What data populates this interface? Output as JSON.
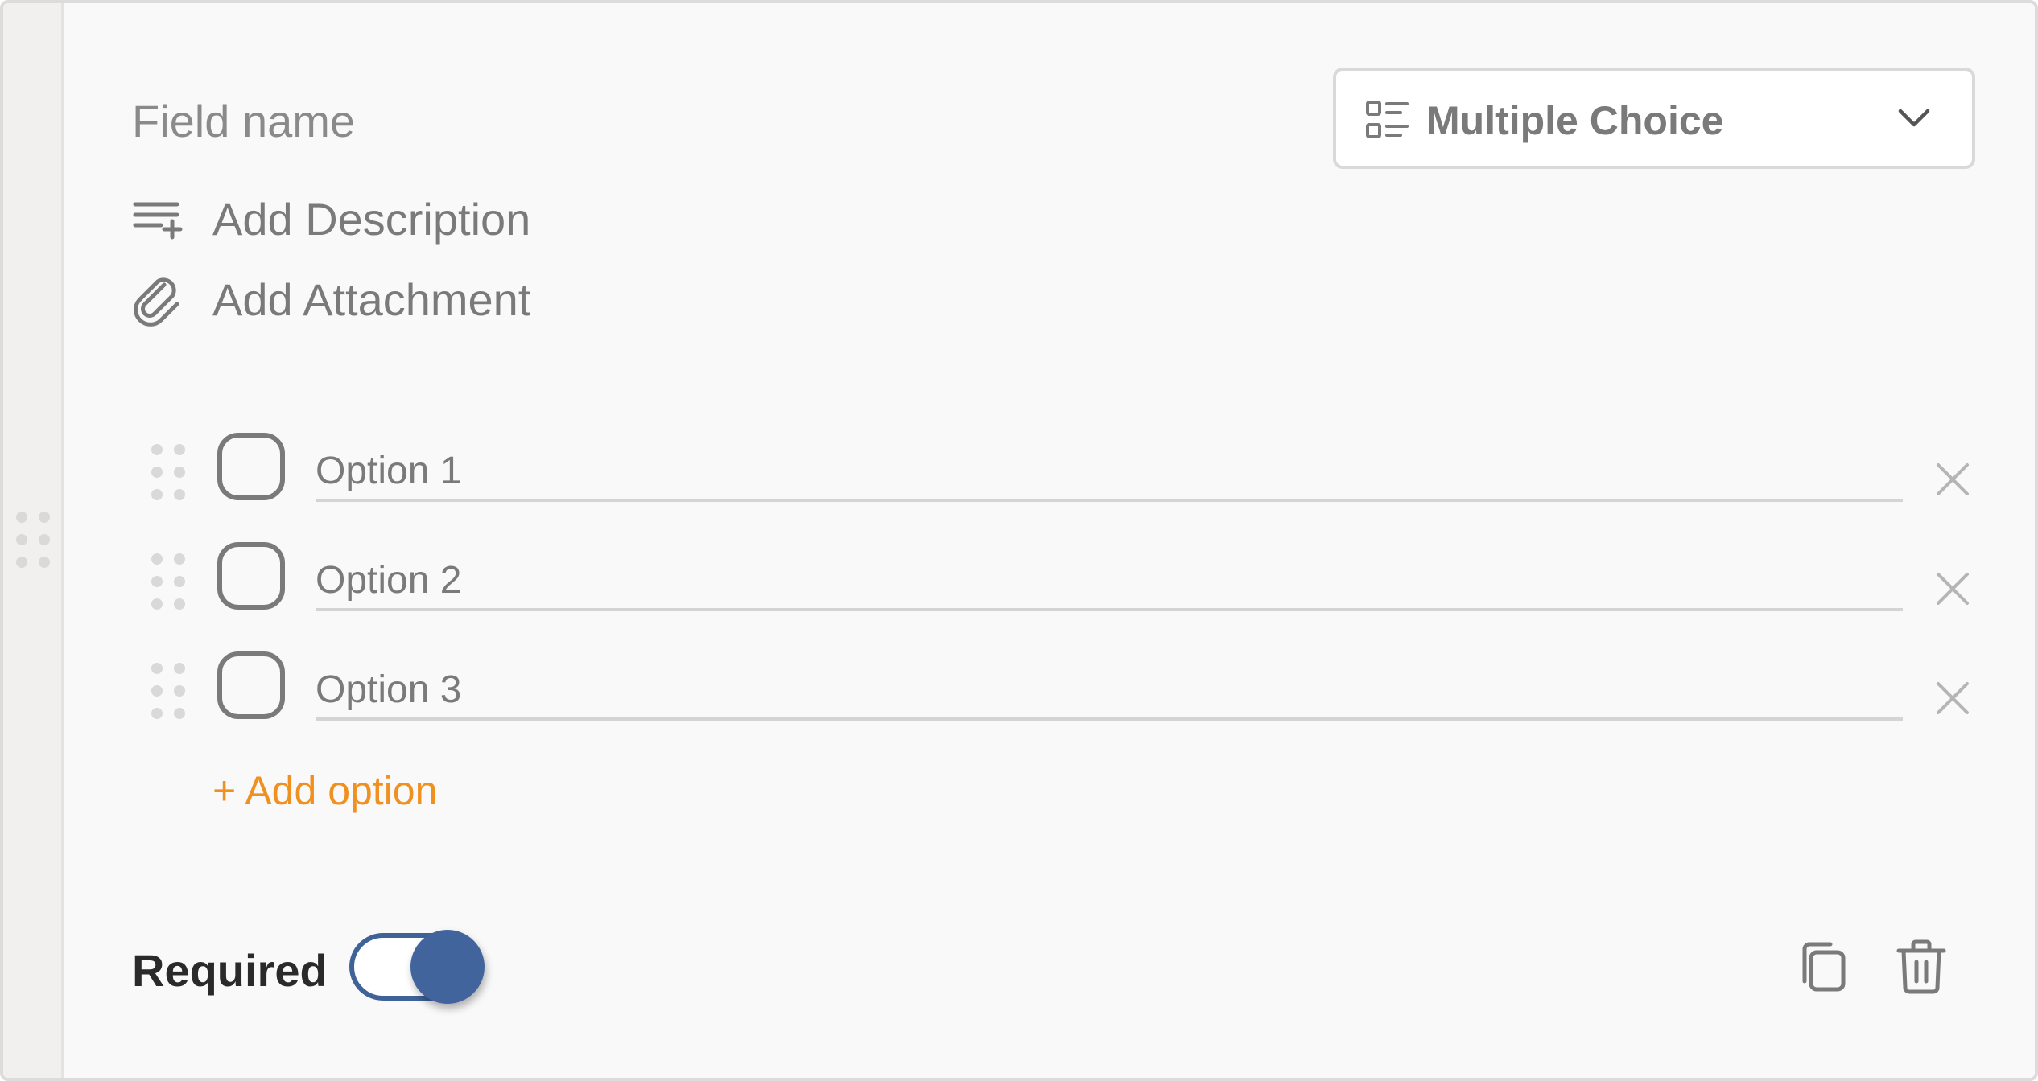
{
  "field": {
    "name_placeholder": "Field name",
    "type": {
      "label": "Multiple Choice",
      "icon": "list-checkbox-icon"
    }
  },
  "actions": {
    "add_description": {
      "label": "Add Description",
      "icon": "text-plus-icon"
    },
    "add_attachment": {
      "label": "Add Attachment",
      "icon": "paperclip-icon"
    }
  },
  "options": [
    {
      "label": "Option 1"
    },
    {
      "label": "Option 2"
    },
    {
      "label": "Option 3"
    }
  ],
  "add_option_label": "+ Add option",
  "footer": {
    "required_label": "Required",
    "required_on": true,
    "copy_icon": "duplicate-icon",
    "delete_icon": "trash-icon"
  },
  "colors": {
    "accent_orange": "#f09020",
    "toggle_blue": "#42649c",
    "text_gray": "#7a7a7a"
  }
}
